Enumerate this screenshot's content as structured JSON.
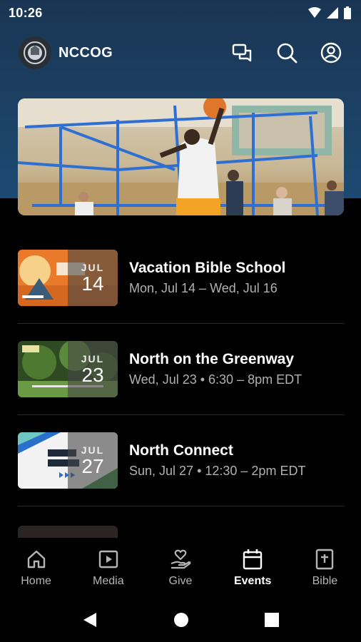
{
  "status_bar": {
    "time": "10:26"
  },
  "app_bar": {
    "title": "NCCOG"
  },
  "icons": {
    "logo": "church-seal-logo",
    "chat": "chat-bubbles-icon",
    "search": "search-icon",
    "profile": "account-circle-icon"
  },
  "events": [
    {
      "title": "Vacation Bible School",
      "time": "Mon, Jul 14 – Wed, Jul 16",
      "month": "JUL",
      "day": "14"
    },
    {
      "title": "North on the Greenway",
      "time": "Wed, Jul 23 • 6:30 – 8pm EDT",
      "month": "JUL",
      "day": "23"
    },
    {
      "title": "North Connect",
      "time": "Sun, Jul 27 • 12:30 – 2pm EDT",
      "month": "JUL",
      "day": "27"
    }
  ],
  "bottom_nav": [
    {
      "label": "Home",
      "icon": "home-icon",
      "active": false
    },
    {
      "label": "Media",
      "icon": "play-icon",
      "active": false
    },
    {
      "label": "Give",
      "icon": "give-hand-heart-icon",
      "active": false
    },
    {
      "label": "Events",
      "icon": "calendar-icon",
      "active": true
    },
    {
      "label": "Bible",
      "icon": "bible-icon",
      "active": false
    }
  ],
  "colors": {
    "header_top": "#1a3553",
    "header_bottom": "#1d4a72",
    "background": "#000000",
    "active_nav": "#ffffff",
    "inactive_nav": "#b5b5b5",
    "secondary_text": "#b0b0b0"
  }
}
